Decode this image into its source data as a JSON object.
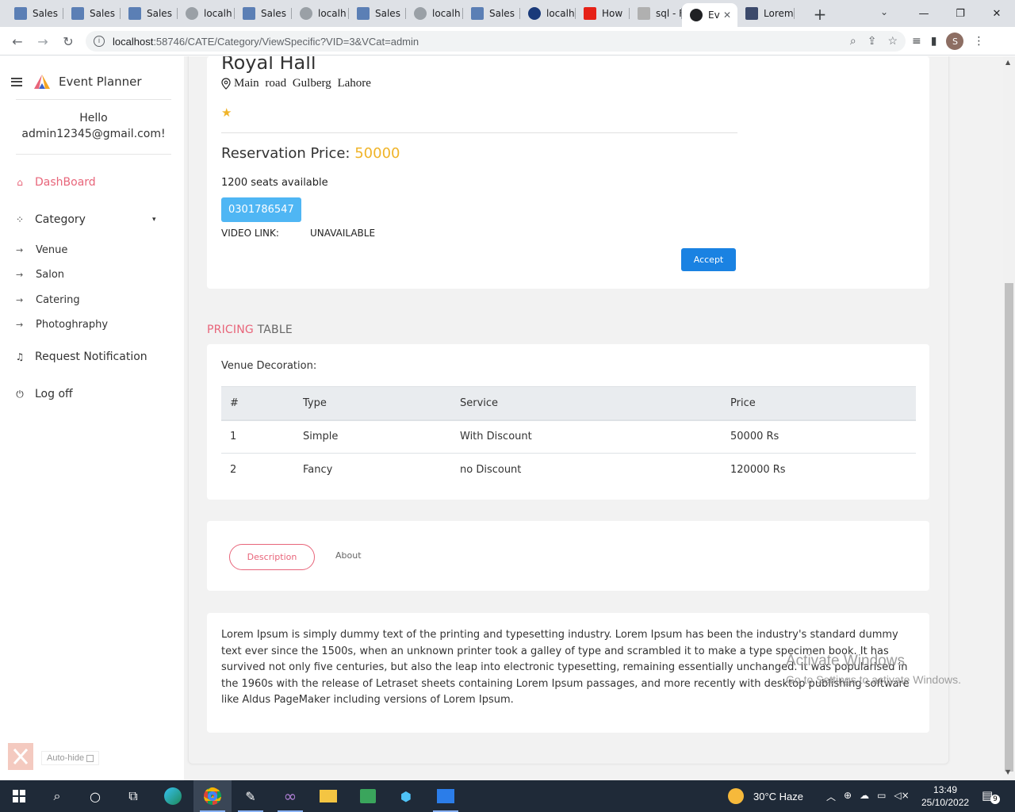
{
  "browser": {
    "tabs": [
      {
        "label": "Sales",
        "icon": "app-icon",
        "color": "#5b7fb5"
      },
      {
        "label": "Sales",
        "icon": "app-icon",
        "color": "#5b7fb5"
      },
      {
        "label": "Sales",
        "icon": "app-icon",
        "color": "#5b7fb5"
      },
      {
        "label": "localh",
        "icon": "globe-icon",
        "color": "#9aa0a6"
      },
      {
        "label": "Sales",
        "icon": "app-icon",
        "color": "#5b7fb5"
      },
      {
        "label": "localh",
        "icon": "globe-icon",
        "color": "#9aa0a6"
      },
      {
        "label": "Sales",
        "icon": "app-icon",
        "color": "#5b7fb5"
      },
      {
        "label": "localh",
        "icon": "globe-icon",
        "color": "#9aa0a6"
      },
      {
        "label": "Sales",
        "icon": "app-icon",
        "color": "#5b7fb5"
      },
      {
        "label": "localh",
        "icon": "globe-icon",
        "color": "#1a3a7a"
      },
      {
        "label": "How",
        "icon": "youtube-icon",
        "color": "#e62117"
      },
      {
        "label": "sql - F",
        "icon": "stackoverflow-icon",
        "color": "#b0b0b0"
      },
      {
        "label": "Ev",
        "icon": "globe-icon",
        "color": "#202124"
      },
      {
        "label": "Lorem",
        "icon": "lorem-icon",
        "color": "#3c4a6b"
      }
    ],
    "url_host": "localhost",
    "url_path": ":58746/CATE/Category/ViewSpecific?VID=3&VCat=admin",
    "profile_initial": "S"
  },
  "sidebar": {
    "brand": "Event Planner",
    "greeting_line1": "Hello",
    "greeting_line2": "admin12345@gmail.com!",
    "dashboard": "DashBoard",
    "category": "Category",
    "sub_items": [
      "Venue",
      "Salon",
      "Catering",
      "Photoghraphy"
    ],
    "request_notification": "Request Notification",
    "logoff": "Log off",
    "autohide": "Auto-hide"
  },
  "venue": {
    "name": "Royal Hall",
    "address": "Main road Gulberg Lahore",
    "rating": 1,
    "price_label": "Reservation Price: ",
    "price_value": "50000",
    "seats": "1200 seats available",
    "phone": "0301786547",
    "video_label": "VIDEO LINK:",
    "video_value": "UNAVAILABLE",
    "accept": "Accept"
  },
  "pricing": {
    "heading_accent": "PRICING",
    "heading_rest": " TABLE",
    "table_label": "Venue Decoration:",
    "columns": [
      "#",
      "Type",
      "Service",
      "Price"
    ],
    "rows": [
      [
        "1",
        "Simple",
        "With Discount",
        "50000 Rs"
      ],
      [
        "2",
        "Fancy",
        "no Discount",
        "120000 Rs"
      ]
    ]
  },
  "tabs": {
    "description": "Description",
    "about": "About"
  },
  "description_text": "Lorem Ipsum is simply dummy text of the printing and typesetting industry. Lorem Ipsum has been the industry's standard dummy text ever since the 1500s, when an unknown printer took a galley of type and scrambled it to make a type specimen book. It has survived not only five centuries, but also the leap into electronic typesetting, remaining essentially unchanged. It was popularised in the 1960s with the release of Letraset sheets containing Lorem Ipsum passages, and more recently with desktop publishing software like Aldus PageMaker including versions of Lorem Ipsum.",
  "watermark": {
    "line1": "Activate Windows",
    "line2": "Go to Settings to activate Windows."
  },
  "taskbar": {
    "weather": "30°C  Haze",
    "time": "13:49",
    "date": "25/10/2022",
    "notifications": "9"
  },
  "colors": {
    "accent_pink": "#e8657a",
    "price_gold": "#f0b429",
    "phone_blue": "#4fb6f4",
    "accept_blue": "#1a82e2"
  }
}
